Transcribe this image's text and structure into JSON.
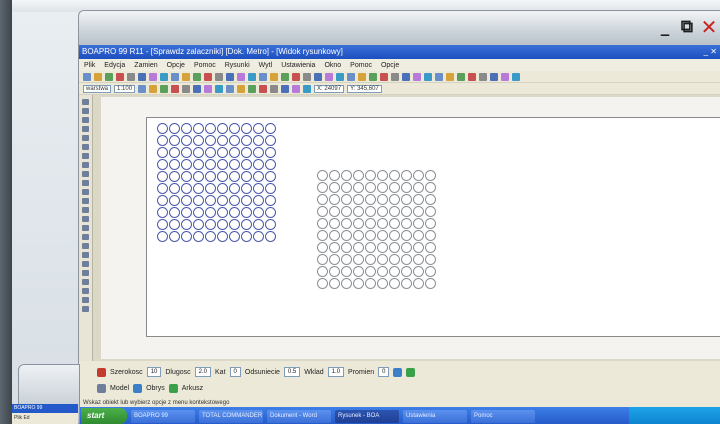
{
  "app_title": "BOAPRO 99 R11 - [Sprawdz zalaczniki] [Dok. Metro] - [Widok rysunkowy]",
  "app_title_right": "_ ✕",
  "menu": [
    "Plik",
    "Edycja",
    "Zamien",
    "Opcje",
    "Pomoc",
    "Rysunki",
    "Wytl",
    "Ustawienia",
    "Okno",
    "Pomoc",
    "Opcje"
  ],
  "toolbar": {
    "scale_combo": "1:100",
    "layer_combo": "warstwa",
    "coord_a": "X: 24097",
    "coord_b": "Y: 345,607"
  },
  "window_controls": {
    "minimize": "_",
    "restore": "⧉",
    "close": "✕"
  },
  "colors": {
    "accent": "#2459c9",
    "circle_blue": "#4a58a8",
    "close_red": "#c8231f"
  },
  "status": {
    "row1": [
      "Szerokosc",
      "Dlugosc",
      "Kat",
      "Odsuniecie",
      "Wklad",
      "Promien"
    ],
    "row1_values": [
      "10",
      "2.0",
      "0",
      "0.5",
      "1.0",
      "0"
    ],
    "row2": [
      "Model",
      "Obrys",
      "Arkusz"
    ]
  },
  "hint": "Wskaz obiekt lub wybierz opcje z menu kontekstowego",
  "taskbar": {
    "start": "start",
    "tasks": [
      "BOAPRO 99",
      "TOTAL COMMANDER",
      "Dokument - Word",
      "Rysunek - BOA",
      "Ustawienia",
      "Pomoc"
    ]
  },
  "mini_window": {
    "title": "BOAPRO 99",
    "menu": "Plik Ed"
  }
}
